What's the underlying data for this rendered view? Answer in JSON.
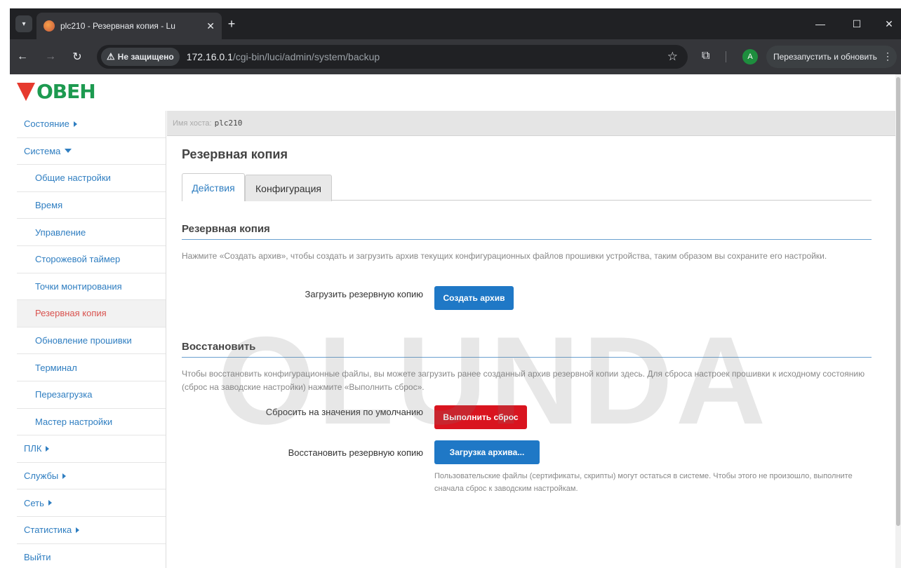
{
  "browser": {
    "tab_title": "plc210 - Резервная копия - Lu",
    "security_label": "Не защищено",
    "url_host": "172.16.0.1",
    "url_path": "/cgi-bin/luci/admin/system/backup",
    "profile_initial": "A",
    "restart_label": "Перезапустить и обновить"
  },
  "logo_text": "ОВЕН",
  "sidebar": {
    "items": [
      {
        "label": "Состояние"
      },
      {
        "label": "Система"
      },
      {
        "label": "Общие настройки"
      },
      {
        "label": "Время"
      },
      {
        "label": "Управление"
      },
      {
        "label": "Сторожевой таймер"
      },
      {
        "label": "Точки монтирования"
      },
      {
        "label": "Резервная копия"
      },
      {
        "label": "Обновление прошивки"
      },
      {
        "label": "Терминал"
      },
      {
        "label": "Перезагрузка"
      },
      {
        "label": "Мастер настройки"
      },
      {
        "label": "ПЛК"
      },
      {
        "label": "Службы"
      },
      {
        "label": "Сеть"
      },
      {
        "label": "Статистика"
      },
      {
        "label": "Выйти"
      }
    ]
  },
  "hostbar": {
    "label": "Имя хоста:",
    "value": "plc210"
  },
  "main": {
    "title": "Резервная копия",
    "tabs": [
      {
        "label": "Действия"
      },
      {
        "label": "Конфигурация"
      }
    ],
    "backup": {
      "heading": "Резервная копия",
      "description": "Нажмите «Создать архив», чтобы создать и загрузить архив текущих конфигурационных файлов прошивки устройства, таким образом вы сохраните его настройки.",
      "download_label": "Загрузить резервную копию",
      "create_button": "Создать архив"
    },
    "restore": {
      "heading": "Восстановить",
      "description": "Чтобы восстановить конфигурационные файлы, вы можете загрузить ранее созданный архив резервной копии здесь. Для сброса настроек прошивки к исходному состоянию (сброс на заводские настройки) нажмите «Выполнить сброс».",
      "reset_label": "Сбросить на значения по умолчанию",
      "reset_button": "Выполнить сброс",
      "restore_label": "Восстановить резервную копию",
      "upload_button": "Загрузка архива...",
      "help": "Пользовательские файлы (сертификаты, скрипты) могут остаться в системе. Чтобы этого не произошло, выполните сначала сброс к заводским настройкам."
    }
  },
  "watermark": "OLUNDA"
}
